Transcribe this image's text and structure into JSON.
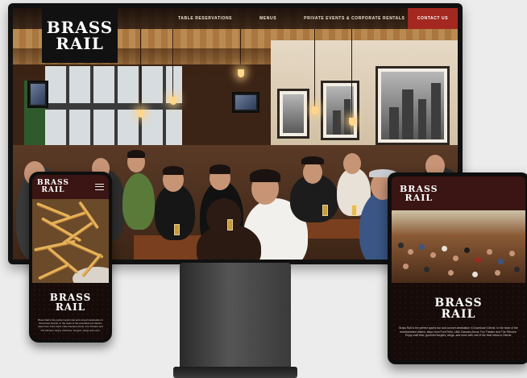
{
  "brand": {
    "logo_line1": "BRASS",
    "logo_line2": "RAIL",
    "accent_color": "#a3281f",
    "header_color": "#3a1513"
  },
  "desktop": {
    "nav": [
      {
        "label": "TABLE RESERVATIONS"
      },
      {
        "label": "MENUS"
      },
      {
        "label": "PRIVATE EVENTS & CORPORATE RENTALS"
      }
    ],
    "contact_label": "CONTACT US"
  },
  "phone": {
    "menu_icon": "hamburger-icon",
    "body_text": "Brass Rail is the perfect sports bar and concert destination in Downtown Detroit. In the heart of the entertainment district, steps from Ford Field, Little Caesars Arena, Fox Theatre and The Fillmore. Enjoy craft beer, burgers, wings and more."
  },
  "tablet": {
    "body_text": "Brass Rail is the perfect sports bar and concert destination in Downtown Detroit. In the heart of the entertainment district, steps from Ford Field, Little Caesars Arena, Fox Theatre and The Fillmore. Enjoy craft beer, gourmet burgers, wings, and more with one of the best views in Detroit."
  }
}
